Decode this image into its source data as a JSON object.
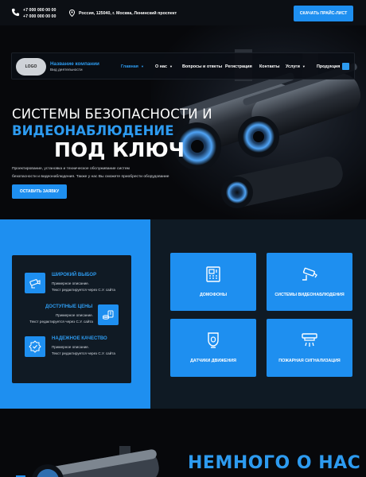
{
  "topbar": {
    "phones": [
      "+7 000 000 00 00",
      "+7 000 000 00 00"
    ],
    "address": "Россия, 125040, г. Москва, Ленинский проспект",
    "price_button": "СКАЧАТЬ ПРАЙС-ЛИСТ"
  },
  "nav": {
    "logo": "LOGO",
    "company_name": "Название компании",
    "company_sub": "Вид деятельности",
    "items": [
      "Главная",
      "О нас",
      "Вопросы и ответы",
      "Регистрация",
      "Контакты",
      "Услуги",
      "Продукция"
    ]
  },
  "hero": {
    "line1": "СИСТЕМЫ БЕЗОПАСНОСТИ И",
    "line2": "ВИДЕОНАБЛЮДЕНИЕ",
    "line3": "ПОД КЛЮЧ",
    "desc_line1": "Проектирование, установка и техническое обслуживание систем",
    "desc_line2": "безопасности и видеонаблюдения. Также у нас Вы сможете приобрести оборудование",
    "button": "ОСТАВИТЬ ЗАЯВКУ"
  },
  "features": [
    {
      "title": "ШИРОКИЙ ВЫБОР",
      "text1": "Примерное описание.",
      "text2": "Текст редактируется через С.У. сайта",
      "icon": "camera-icon"
    },
    {
      "title": "ДОСТУПНЫЕ ЦЕНЫ",
      "text1": "Примерное описание.",
      "text2": "Текст редактируется через С.У. сайта",
      "icon": "money-icon"
    },
    {
      "title": "НАДЕЖНОЕ КАЧЕСТВО",
      "text1": "Примерное описание.",
      "text2": "Текст редактируется через С.У. сайта",
      "icon": "quality-badge-icon"
    }
  ],
  "services": [
    {
      "label": "ДОМОФОНЫ",
      "icon": "intercom-icon"
    },
    {
      "label": "СИСТЕМЫ ВИДЕОНАБЛЮДЕНИЯ",
      "icon": "cctv-icon"
    },
    {
      "label": "ДАТЧИКИ ДВИЖЕНИЯ",
      "icon": "motion-sensor-icon"
    },
    {
      "label": "ПОЖАРНАЯ СИГНАЛИЗАЦИЯ",
      "icon": "fire-alarm-icon"
    }
  ],
  "about": {
    "title": "НЕМНОГО О НАС"
  },
  "colors": {
    "accent": "#1e8ff0",
    "dark_bg": "#07080b",
    "panel": "#101a24"
  }
}
